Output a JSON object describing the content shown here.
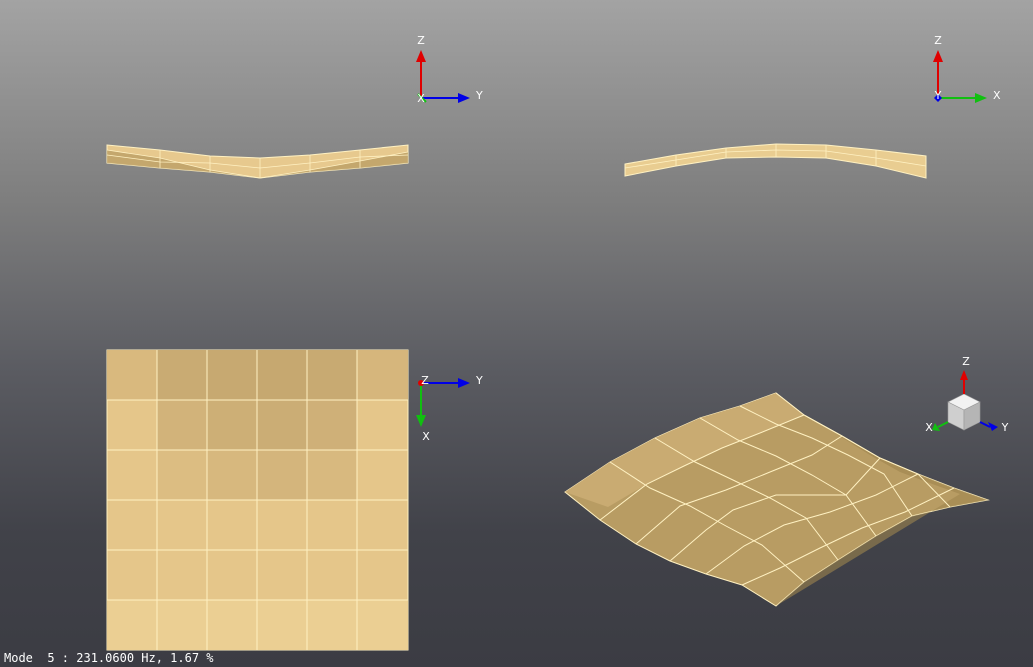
{
  "status": {
    "mode_text": "Mode  5 : 231.0600 Hz, 1.67 %"
  },
  "axes_labels": {
    "x": "X",
    "y": "Y",
    "z": "Z"
  },
  "colors": {
    "mesh_fill": "#e9cc8f",
    "mesh_edge": "#fff2c4",
    "axis_x_red": "#e00000",
    "axis_y_blue": "#0000e6",
    "axis_green": "#10c010",
    "triad_cube": "#e6e6e6"
  },
  "icons": {
    "triad": "coordinate-triad-icon",
    "view_cube": "view-cube-icon"
  },
  "viewports": [
    {
      "name": "front-view",
      "view": "Y-Z"
    },
    {
      "name": "side-view",
      "view": "X-Z"
    },
    {
      "name": "top-view",
      "view": "X-Y"
    },
    {
      "name": "iso-view",
      "view": "isometric"
    }
  ]
}
